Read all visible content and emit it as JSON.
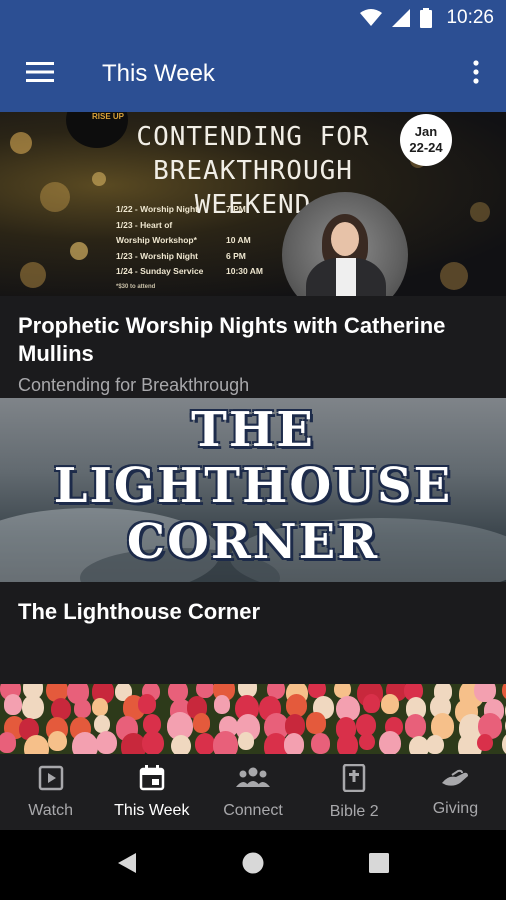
{
  "status_bar": {
    "time": "10:26",
    "icons": [
      "wifi-icon",
      "signal-icon",
      "battery-icon"
    ]
  },
  "app_bar": {
    "title": "This Week",
    "menu_icon": "hamburger-menu-icon",
    "overflow_icon": "more-vertical-icon"
  },
  "cards": [
    {
      "image": {
        "logo_text": "RISE UP",
        "headline": "CONTENDING FOR BREAKTHROUGH WEEKEND",
        "date_badge": "Jan 22-24",
        "date_badge_line1": "Jan",
        "date_badge_line2": "22-24",
        "schedule": [
          {
            "event": "1/22 - Worship Night",
            "time": "7 PM"
          },
          {
            "event": "1/23 - Heart of",
            "time": ""
          },
          {
            "event": "Worship Workshop*",
            "time": "10 AM"
          },
          {
            "event": "1/23 - Worship Night",
            "time": "6 PM"
          },
          {
            "event": "1/24 - Sunday Service",
            "time": "10:30 AM"
          }
        ],
        "note": "*$30 to attend"
      },
      "title": "Prophetic Worship Nights with Catherine Mullins",
      "subtitle": "Contending for Breakthrough"
    },
    {
      "image": {
        "headline_lines": [
          "THE",
          "LIGHTHOUSE",
          "CORNER"
        ]
      },
      "title": "The Lighthouse Corner",
      "subtitle": ""
    },
    {
      "image": {
        "description": ""
      },
      "title": "",
      "subtitle": ""
    }
  ],
  "bottom_nav": {
    "items": [
      {
        "label": "Watch",
        "icon": "play-icon",
        "active": false
      },
      {
        "label": "This Week",
        "icon": "calendar-icon",
        "active": true
      },
      {
        "label": "Connect",
        "icon": "people-icon",
        "active": false
      },
      {
        "label": "Bible 2",
        "icon": "bible-icon",
        "active": false
      },
      {
        "label": "Giving",
        "icon": "giving-hand-icon",
        "active": false
      }
    ]
  },
  "system_nav": {
    "back_icon": "back-icon",
    "home_icon": "home-icon",
    "recents_icon": "recents-icon"
  },
  "colors": {
    "app_bar": "#2c4f93",
    "background": "#1b1b1d",
    "nav_bar": "#1e1e20",
    "active": "#ffffff",
    "inactive": "#a8a8ab"
  }
}
